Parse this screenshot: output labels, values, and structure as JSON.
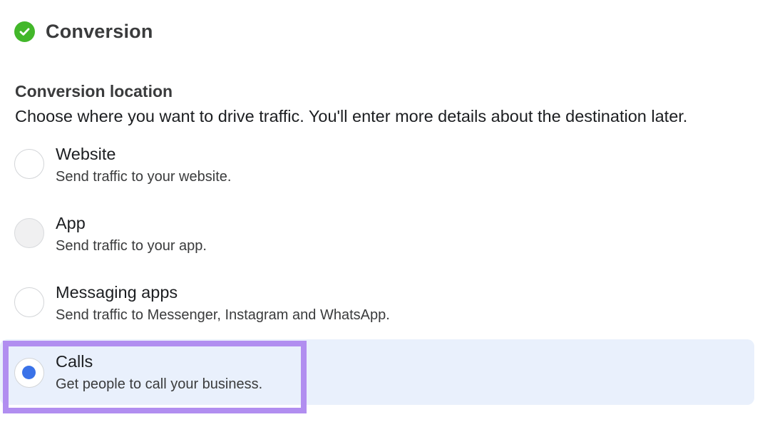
{
  "section": {
    "title": "Conversion",
    "status_icon": "check-circle-icon",
    "status_color": "#42b72a"
  },
  "field": {
    "label": "Conversion location",
    "description": "Choose where you want to drive traffic. You'll enter more details about the destination later."
  },
  "options": [
    {
      "title": "Website",
      "subtitle": "Send traffic to your website.",
      "selected": false,
      "disabled": false
    },
    {
      "title": "App",
      "subtitle": "Send traffic to your app.",
      "selected": false,
      "disabled": true
    },
    {
      "title": "Messaging apps",
      "subtitle": "Send traffic to Messenger, Instagram and WhatsApp.",
      "selected": false,
      "disabled": false
    },
    {
      "title": "Calls",
      "subtitle": "Get people to call your business.",
      "selected": true,
      "disabled": false
    }
  ],
  "colors": {
    "selected_radio": "#3a72e8",
    "selected_row_bg": "#e9f0fc",
    "highlight_outline": "#b18ef0"
  }
}
